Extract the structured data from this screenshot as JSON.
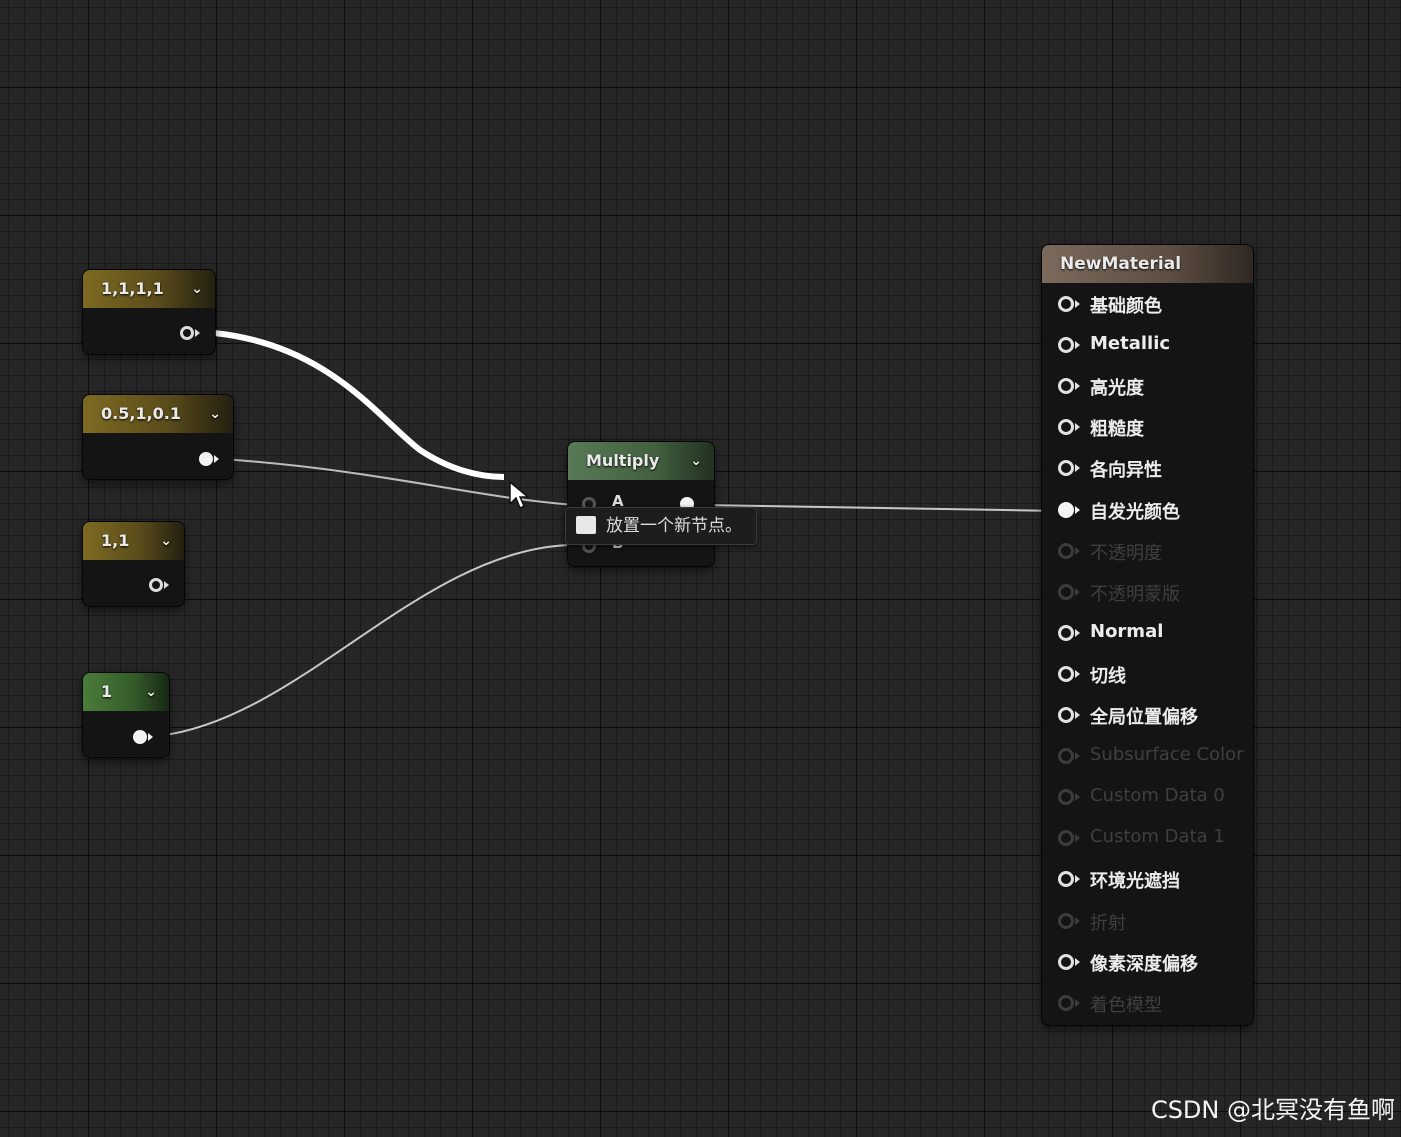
{
  "constant_nodes": [
    {
      "value": "1,1,1,1",
      "header_color": "gold"
    },
    {
      "value": "0.5,1,0.1",
      "header_color": "gold"
    },
    {
      "value": "1,1",
      "header_color": "gold"
    },
    {
      "value": "1",
      "header_color": "green"
    }
  ],
  "multiply_node": {
    "title": "Multiply",
    "pin_a": "A",
    "pin_b": "B"
  },
  "tooltip": {
    "text": "放置一个新节点。"
  },
  "material_node": {
    "title": "NewMaterial",
    "pins": [
      {
        "label": "基础颜色",
        "state": "active"
      },
      {
        "label": "Metallic",
        "state": "active"
      },
      {
        "label": "高光度",
        "state": "active"
      },
      {
        "label": "粗糙度",
        "state": "active"
      },
      {
        "label": "各向异性",
        "state": "active"
      },
      {
        "label": "自发光颜色",
        "state": "connected"
      },
      {
        "label": "不透明度",
        "state": "disabled"
      },
      {
        "label": "不透明蒙版",
        "state": "disabled"
      },
      {
        "label": "Normal",
        "state": "active"
      },
      {
        "label": "切线",
        "state": "active"
      },
      {
        "label": "全局位置偏移",
        "state": "active"
      },
      {
        "label": "Subsurface Color",
        "state": "disabled"
      },
      {
        "label": "Custom Data 0",
        "state": "disabled"
      },
      {
        "label": "Custom Data 1",
        "state": "disabled"
      },
      {
        "label": "环境光遮挡",
        "state": "active"
      },
      {
        "label": "折射",
        "state": "disabled"
      },
      {
        "label": "像素深度偏移",
        "state": "active"
      },
      {
        "label": "着色模型",
        "state": "disabled"
      }
    ]
  },
  "watermark": "CSDN @北冥没有鱼啊",
  "colors": {
    "canvas": "#262626",
    "node_body": "#141414",
    "gold_header": "#7e6a22",
    "green_header": "#4b7d3a",
    "multiply_header": "#587a55",
    "material_header": "#7b6a5c"
  }
}
